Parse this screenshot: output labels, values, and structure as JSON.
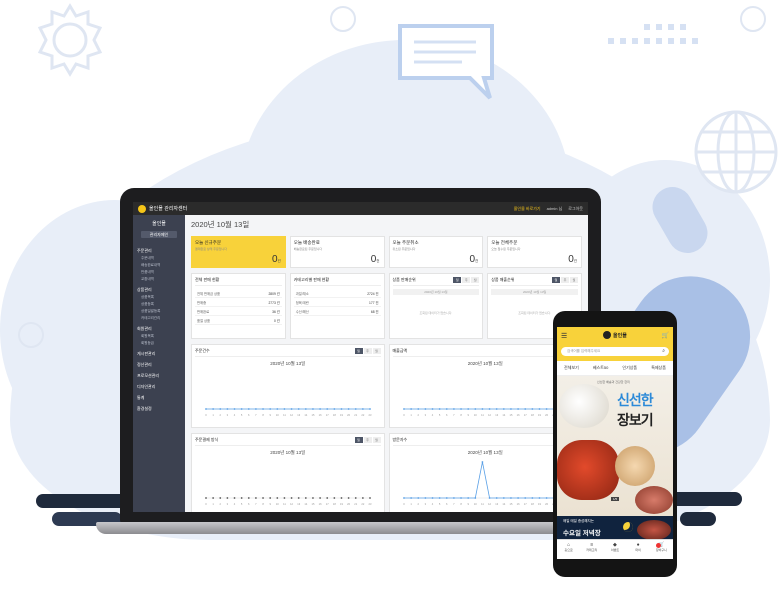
{
  "app": {
    "title": "올인몰 관리자센터",
    "top_links": [
      "올인몰 바로가기",
      "admin 님",
      "로그아웃"
    ]
  },
  "sidebar": {
    "brand": "올인몰",
    "button": "관리자메인",
    "groups": [
      {
        "label": "주문관리",
        "items": [
          "주문내역",
          "배송완료내역",
          "반품내역",
          "교환내역"
        ]
      },
      {
        "label": "상품관리",
        "items": [
          "상품목록",
          "상품등록",
          "상품일괄등록",
          "카테고리관리"
        ]
      },
      {
        "label": "회원관리",
        "items": [
          "회원목록",
          "회원등급"
        ]
      },
      {
        "label": "게시판관리",
        "items": []
      },
      {
        "label": "정산관리",
        "items": []
      },
      {
        "label": "프로모션관리",
        "items": []
      },
      {
        "label": "디자인관리",
        "items": []
      },
      {
        "label": "통계",
        "items": []
      },
      {
        "label": "환경설정",
        "items": []
      }
    ]
  },
  "dashboard": {
    "date_title": "2020년 10월 13일",
    "stats": [
      {
        "label": "오늘 신규주문",
        "sub": "결제완료 상태 주문입니다",
        "value": "0",
        "unit": "건"
      },
      {
        "label": "오늘 배송완료",
        "sub": "배송완료된 주문입니다",
        "value": "0",
        "unit": "건"
      },
      {
        "label": "오늘 주문취소",
        "sub": "취소된 주문입니다",
        "value": "0",
        "unit": "건"
      },
      {
        "label": "오늘 전체주문",
        "sub": "오늘 접수된 주문입니다",
        "value": "0",
        "unit": "건"
      }
    ],
    "panel1": {
      "title": "전체 판매 현황",
      "rows": [
        {
          "k": "전체 판매금 상품",
          "v": "2809 건"
        },
        {
          "k": "판매중",
          "v": "2773 건"
        },
        {
          "k": "판매완료",
          "v": "36 건"
        },
        {
          "k": "품절 상품",
          "v": "0 건"
        }
      ]
    },
    "panel2": {
      "title": "카테고리별 판매 현황",
      "rows": [
        {
          "k": "과일/채소",
          "v": "2724 건"
        },
        {
          "k": "정육/계란",
          "v": "177 건"
        },
        {
          "k": "수산/해산",
          "v": "68 건"
        }
      ]
    },
    "panel3": {
      "title": "상품 판매순위",
      "date": "2020년 10월 13일",
      "empty": "조회된 데이터가 없습니다."
    },
    "panel4": {
      "title": "상품 매출순위",
      "date": "2020년 10월 13일",
      "empty": "조회된 데이터가 없습니다."
    },
    "pager": [
      "일",
      "주",
      "월"
    ],
    "chart_titles": [
      "주문건수",
      "매출금액",
      "주문결제 방식",
      "방문자수"
    ],
    "chart_date": "2020년 10월 13일"
  },
  "chart_data": [
    {
      "type": "line",
      "title": "주문건수",
      "x": [
        0,
        1,
        2,
        3,
        4,
        5,
        6,
        7,
        8,
        9,
        10,
        11,
        12,
        13,
        14,
        15,
        16,
        17,
        18,
        19,
        20,
        21,
        22,
        23
      ],
      "values": [
        0,
        0,
        0,
        0,
        0,
        0,
        0,
        0,
        0,
        0,
        0,
        0,
        0,
        0,
        0,
        0,
        0,
        0,
        0,
        0,
        0,
        0,
        0,
        0
      ]
    },
    {
      "type": "line",
      "title": "매출금액",
      "x": [
        0,
        1,
        2,
        3,
        4,
        5,
        6,
        7,
        8,
        9,
        10,
        11,
        12,
        13,
        14,
        15,
        16,
        17,
        18,
        19,
        20,
        21,
        22,
        23
      ],
      "values": [
        0,
        0,
        0,
        0,
        0,
        0,
        0,
        0,
        0,
        0,
        0,
        0,
        0,
        0,
        0,
        0,
        0,
        0,
        0,
        0,
        0,
        0,
        0,
        0
      ]
    },
    {
      "type": "scatter",
      "title": "주문결제 방식",
      "x": [
        0,
        1,
        2,
        3,
        4,
        5,
        6,
        7,
        8,
        9,
        10,
        11,
        12,
        13,
        14,
        15,
        16,
        17,
        18,
        19,
        20,
        21,
        22,
        23
      ],
      "values": [
        0,
        0,
        0,
        0,
        0,
        0,
        0,
        0,
        0,
        0,
        0,
        0,
        0,
        0,
        0,
        0,
        0,
        0,
        0,
        0,
        0,
        0,
        0,
        0
      ]
    },
    {
      "type": "line",
      "title": "방문자수",
      "x": [
        0,
        1,
        2,
        3,
        4,
        5,
        6,
        7,
        8,
        9,
        10,
        11,
        12,
        13,
        14,
        15,
        16,
        17,
        18,
        19,
        20,
        21,
        22,
        23
      ],
      "values": [
        0,
        0,
        0,
        0,
        0,
        0,
        0,
        0,
        0,
        0,
        0,
        1,
        0,
        0,
        0,
        0,
        0,
        0,
        0,
        0,
        0,
        0,
        0,
        0
      ],
      "ylim": [
        0,
        1
      ]
    }
  ],
  "mobile": {
    "brand": "올인몰",
    "search_placeholder": "검색어를 입력해주세요",
    "tabs": [
      "전체보기",
      "베스트50",
      "인기상품",
      "특제상품"
    ],
    "banner_sub": "신선한 배송과 건강한 한끼",
    "banner_line1": "신선한",
    "banner_line2": "장보기",
    "banner_tag": "1/5",
    "night_line1": "매일 매일 종성해지는",
    "night_line2": "수요일 저녁장",
    "nav": [
      {
        "icon": "home-icon",
        "label": "홈으로"
      },
      {
        "icon": "category-icon",
        "label": "카테고리"
      },
      {
        "icon": "tag-icon",
        "label": "이벤트"
      },
      {
        "icon": "user-icon",
        "label": "마이"
      },
      {
        "icon": "cart-icon",
        "label": "장바구니"
      }
    ]
  }
}
